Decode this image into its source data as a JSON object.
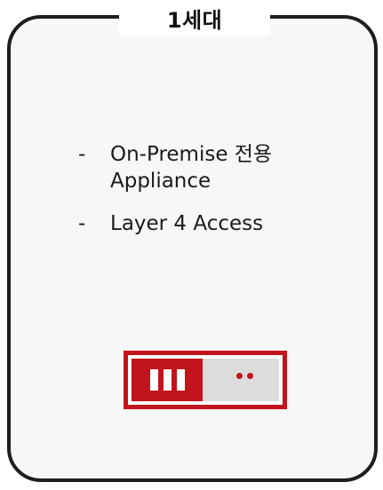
{
  "card": {
    "title": "1세대",
    "bullets": [
      {
        "dash": "-",
        "text": "On-Premise 전용\nAppliance"
      },
      {
        "dash": "-",
        "text": "Layer 4 Access"
      }
    ]
  },
  "colors": {
    "border": "#1e1e1e",
    "card_background": "#f7f7f7",
    "accent": "#c1141b",
    "appliance_panel": "#dcdcdc"
  },
  "icons": {
    "appliance": "server-appliance-icon"
  }
}
